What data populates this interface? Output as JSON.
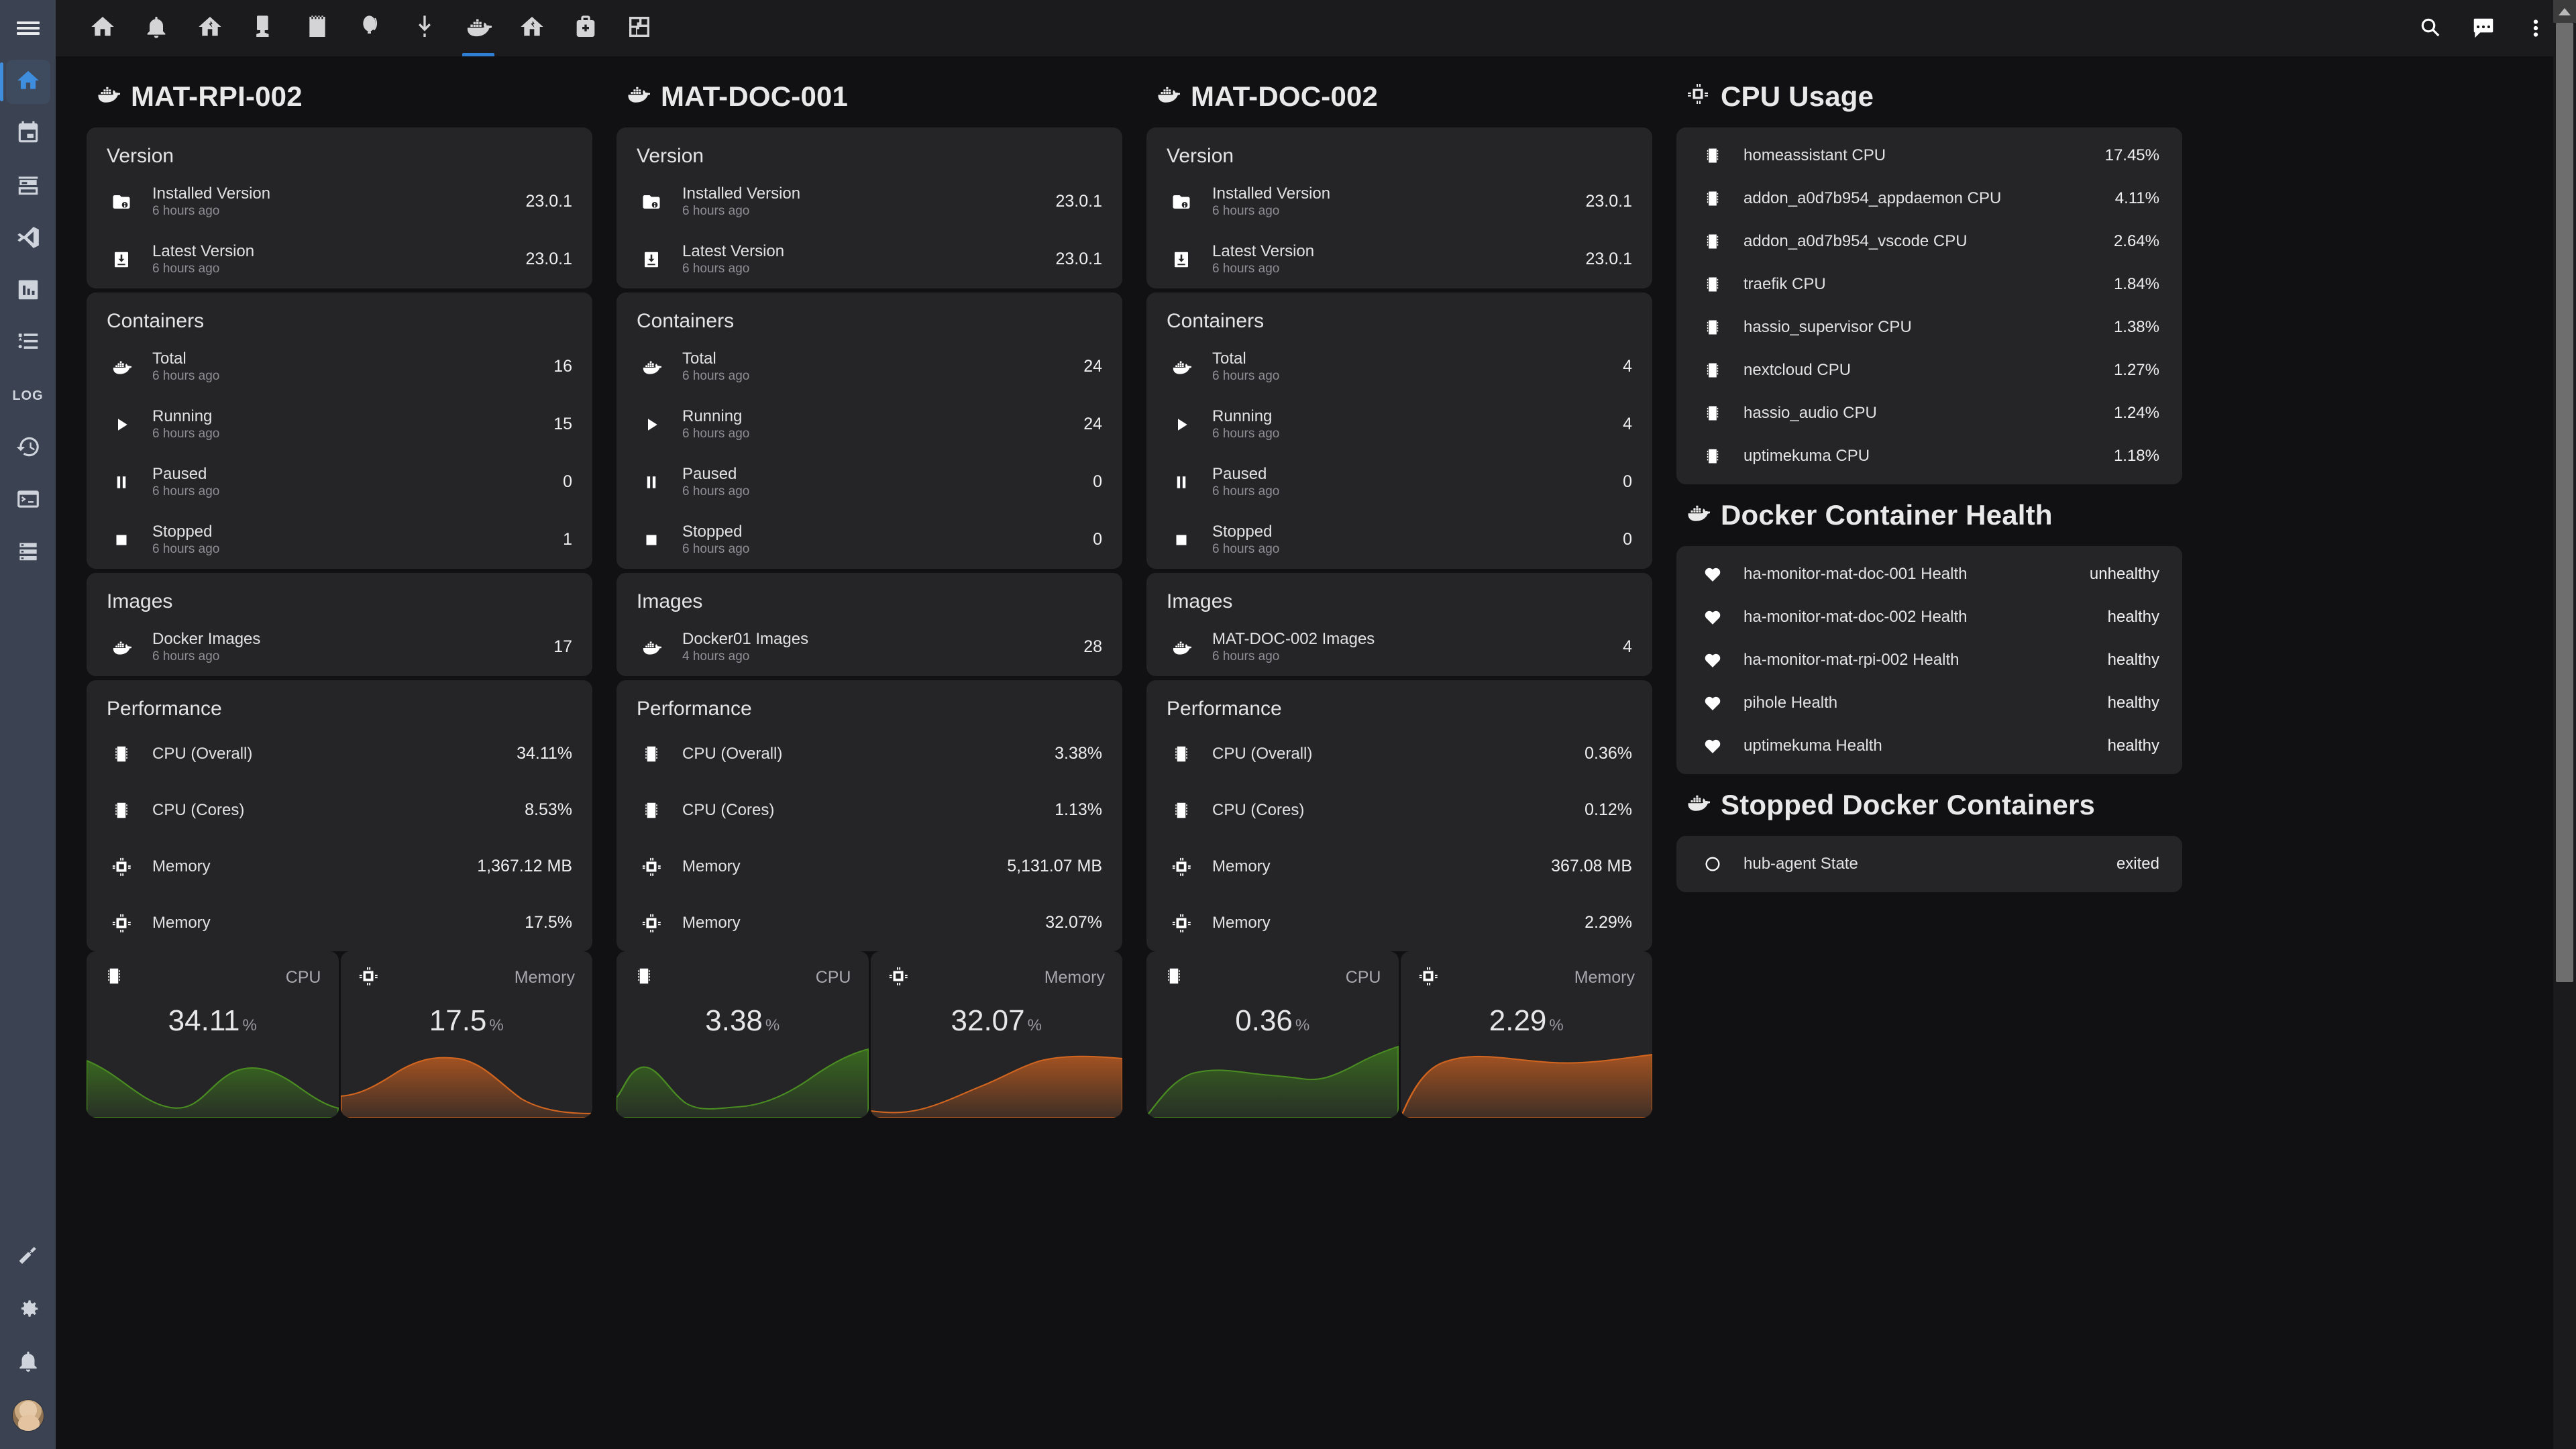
{
  "sidebar": {
    "hamburger": "menu-icon",
    "items": [
      {
        "id": "home",
        "icon": "home-icon",
        "label": "Home",
        "active": true
      },
      {
        "id": "calendar",
        "icon": "calendar-icon",
        "label": "Calendar",
        "active": false
      },
      {
        "id": "hacs",
        "icon": "hacs-icon",
        "label": "HACS",
        "active": false
      },
      {
        "id": "vscode",
        "icon": "vscode-icon",
        "label": "Studio Code Server",
        "active": false
      },
      {
        "id": "grafana",
        "icon": "chart-box-icon",
        "label": "Grafana",
        "active": false
      },
      {
        "id": "logbook",
        "icon": "format-list-icon",
        "label": "Logbook",
        "active": false
      },
      {
        "id": "log",
        "icon": "log-text",
        "label": "LOG",
        "active": false
      },
      {
        "id": "history",
        "icon": "history-icon",
        "label": "History",
        "active": false
      },
      {
        "id": "terminal",
        "icon": "terminal-icon",
        "label": "Terminal",
        "active": false
      },
      {
        "id": "server",
        "icon": "server-icon",
        "label": "Server",
        "active": false
      }
    ],
    "bottom": [
      {
        "id": "developer-tools",
        "icon": "hammer-icon",
        "label": "Developer tools"
      },
      {
        "id": "settings",
        "icon": "gear-icon",
        "label": "Settings"
      },
      {
        "id": "notifications",
        "icon": "bell-icon",
        "label": "Notifications"
      },
      {
        "id": "user",
        "icon": "avatar",
        "label": "User profile"
      }
    ]
  },
  "topbar": {
    "tabs": [
      {
        "id": "home",
        "icon": "home-icon",
        "active": false
      },
      {
        "id": "alerts",
        "icon": "bell-icon",
        "active": false
      },
      {
        "id": "network",
        "icon": "home-lightning-icon",
        "active": false
      },
      {
        "id": "devices",
        "icon": "device-icon",
        "active": false
      },
      {
        "id": "notes",
        "icon": "notebook-icon",
        "active": false
      },
      {
        "id": "weather",
        "icon": "balloon-icon",
        "active": false
      },
      {
        "id": "downloads",
        "icon": "download-icon",
        "active": false
      },
      {
        "id": "docker",
        "icon": "docker-icon",
        "active": true
      },
      {
        "id": "energy",
        "icon": "home-lightning-icon",
        "active": false
      },
      {
        "id": "health",
        "icon": "medical-bag-icon",
        "active": false
      },
      {
        "id": "floorplan",
        "icon": "floorplan-icon",
        "active": false
      }
    ],
    "actions": [
      {
        "id": "search",
        "icon": "search-icon"
      },
      {
        "id": "assist",
        "icon": "assist-chat-icon"
      },
      {
        "id": "overflow",
        "icon": "dots-vertical-icon"
      }
    ]
  },
  "hosts": [
    {
      "title": "MAT-RPI-002",
      "title_icon": "docker-icon",
      "version": {
        "heading": "Version",
        "rows": [
          {
            "icon": "folder-info-icon",
            "name": "Installed Version",
            "sub": "6 hours ago",
            "value": "23.0.1"
          },
          {
            "icon": "file-download-icon",
            "name": "Latest Version",
            "sub": "6 hours ago",
            "value": "23.0.1"
          }
        ]
      },
      "containers": {
        "heading": "Containers",
        "rows": [
          {
            "icon": "docker-icon",
            "name": "Total",
            "sub": "6 hours ago",
            "value": "16"
          },
          {
            "icon": "play-icon",
            "name": "Running",
            "sub": "6 hours ago",
            "value": "15"
          },
          {
            "icon": "pause-icon",
            "name": "Paused",
            "sub": "6 hours ago",
            "value": "0"
          },
          {
            "icon": "stop-icon",
            "name": "Stopped",
            "sub": "6 hours ago",
            "value": "1"
          }
        ]
      },
      "images": {
        "heading": "Images",
        "rows": [
          {
            "icon": "docker-icon",
            "name": "Docker Images",
            "sub": "6 hours ago",
            "value": "17"
          }
        ]
      },
      "performance": {
        "heading": "Performance",
        "rows": [
          {
            "icon": "memory-chip-icon",
            "name": "CPU (Overall)",
            "sub": "",
            "value": "34.11%"
          },
          {
            "icon": "memory-chip-icon",
            "name": "CPU (Cores)",
            "sub": "",
            "value": "8.53%"
          },
          {
            "icon": "cpu-chip-icon",
            "name": "Memory",
            "sub": "",
            "value": "1,367.12 MB"
          },
          {
            "icon": "cpu-chip-icon",
            "name": "Memory",
            "sub": "",
            "value": "17.5%"
          }
        ]
      },
      "gauges": [
        {
          "icon": "memory-chip-icon",
          "label": "CPU",
          "value": "34.11",
          "unit": "%",
          "color": "#3f7d1e"
        },
        {
          "icon": "cpu-chip-icon",
          "label": "Memory",
          "value": "17.5",
          "unit": "%",
          "color": "#b85a20"
        }
      ]
    },
    {
      "title": "MAT-DOC-001",
      "title_icon": "docker-icon",
      "version": {
        "heading": "Version",
        "rows": [
          {
            "icon": "folder-info-icon",
            "name": "Installed Version",
            "sub": "6 hours ago",
            "value": "23.0.1"
          },
          {
            "icon": "file-download-icon",
            "name": "Latest Version",
            "sub": "6 hours ago",
            "value": "23.0.1"
          }
        ]
      },
      "containers": {
        "heading": "Containers",
        "rows": [
          {
            "icon": "docker-icon",
            "name": "Total",
            "sub": "6 hours ago",
            "value": "24"
          },
          {
            "icon": "play-icon",
            "name": "Running",
            "sub": "6 hours ago",
            "value": "24"
          },
          {
            "icon": "pause-icon",
            "name": "Paused",
            "sub": "6 hours ago",
            "value": "0"
          },
          {
            "icon": "stop-icon",
            "name": "Stopped",
            "sub": "6 hours ago",
            "value": "0"
          }
        ]
      },
      "images": {
        "heading": "Images",
        "rows": [
          {
            "icon": "docker-icon",
            "name": "Docker01 Images",
            "sub": "4 hours ago",
            "value": "28"
          }
        ]
      },
      "performance": {
        "heading": "Performance",
        "rows": [
          {
            "icon": "memory-chip-icon",
            "name": "CPU (Overall)",
            "sub": "",
            "value": "3.38%"
          },
          {
            "icon": "memory-chip-icon",
            "name": "CPU (Cores)",
            "sub": "",
            "value": "1.13%"
          },
          {
            "icon": "cpu-chip-icon",
            "name": "Memory",
            "sub": "",
            "value": "5,131.07 MB"
          },
          {
            "icon": "cpu-chip-icon",
            "name": "Memory",
            "sub": "",
            "value": "32.07%"
          }
        ]
      },
      "gauges": [
        {
          "icon": "memory-chip-icon",
          "label": "CPU",
          "value": "3.38",
          "unit": "%",
          "color": "#3f7d1e"
        },
        {
          "icon": "cpu-chip-icon",
          "label": "Memory",
          "value": "32.07",
          "unit": "%",
          "color": "#b85a20"
        }
      ]
    },
    {
      "title": "MAT-DOC-002",
      "title_icon": "docker-icon",
      "version": {
        "heading": "Version",
        "rows": [
          {
            "icon": "folder-info-icon",
            "name": "Installed Version",
            "sub": "6 hours ago",
            "value": "23.0.1"
          },
          {
            "icon": "file-download-icon",
            "name": "Latest Version",
            "sub": "6 hours ago",
            "value": "23.0.1"
          }
        ]
      },
      "containers": {
        "heading": "Containers",
        "rows": [
          {
            "icon": "docker-icon",
            "name": "Total",
            "sub": "6 hours ago",
            "value": "4"
          },
          {
            "icon": "play-icon",
            "name": "Running",
            "sub": "6 hours ago",
            "value": "4"
          },
          {
            "icon": "pause-icon",
            "name": "Paused",
            "sub": "6 hours ago",
            "value": "0"
          },
          {
            "icon": "stop-icon",
            "name": "Stopped",
            "sub": "6 hours ago",
            "value": "0"
          }
        ]
      },
      "images": {
        "heading": "Images",
        "rows": [
          {
            "icon": "docker-icon",
            "name": "MAT-DOC-002 Images",
            "sub": "6 hours ago",
            "value": "4"
          }
        ]
      },
      "performance": {
        "heading": "Performance",
        "rows": [
          {
            "icon": "memory-chip-icon",
            "name": "CPU (Overall)",
            "sub": "",
            "value": "0.36%"
          },
          {
            "icon": "memory-chip-icon",
            "name": "CPU (Cores)",
            "sub": "",
            "value": "0.12%"
          },
          {
            "icon": "cpu-chip-icon",
            "name": "Memory",
            "sub": "",
            "value": "367.08 MB"
          },
          {
            "icon": "cpu-chip-icon",
            "name": "Memory",
            "sub": "",
            "value": "2.29%"
          }
        ]
      },
      "gauges": [
        {
          "icon": "memory-chip-icon",
          "label": "CPU",
          "value": "0.36",
          "unit": "%",
          "color": "#3f7d1e"
        },
        {
          "icon": "cpu-chip-icon",
          "label": "Memory",
          "value": "2.29",
          "unit": "%",
          "color": "#b85a20"
        }
      ]
    }
  ],
  "right": {
    "cpu_usage": {
      "title": "CPU Usage",
      "title_icon": "cpu-64-icon",
      "rows": [
        {
          "icon": "memory-chip-icon",
          "name": "homeassistant CPU",
          "value": "17.45%"
        },
        {
          "icon": "memory-chip-icon",
          "name": "addon_a0d7b954_appdaemon CPU",
          "value": "4.11%"
        },
        {
          "icon": "memory-chip-icon",
          "name": "addon_a0d7b954_vscode CPU",
          "value": "2.64%"
        },
        {
          "icon": "memory-chip-icon",
          "name": "traefik CPU",
          "value": "1.84%"
        },
        {
          "icon": "memory-chip-icon",
          "name": "hassio_supervisor CPU",
          "value": "1.38%"
        },
        {
          "icon": "memory-chip-icon",
          "name": "nextcloud CPU",
          "value": "1.27%"
        },
        {
          "icon": "memory-chip-icon",
          "name": "hassio_audio CPU",
          "value": "1.24%"
        },
        {
          "icon": "memory-chip-icon",
          "name": "uptimekuma CPU",
          "value": "1.18%"
        }
      ]
    },
    "container_health": {
      "title": "Docker Container Health",
      "title_icon": "docker-icon",
      "rows": [
        {
          "icon": "heart-pulse-icon",
          "name": "ha-monitor-mat-doc-001 Health",
          "value": "unhealthy"
        },
        {
          "icon": "heart-pulse-icon",
          "name": "ha-monitor-mat-doc-002 Health",
          "value": "healthy"
        },
        {
          "icon": "heart-pulse-icon",
          "name": "ha-monitor-mat-rpi-002 Health",
          "value": "healthy"
        },
        {
          "icon": "heart-pulse-icon",
          "name": "pihole Health",
          "value": "healthy"
        },
        {
          "icon": "heart-pulse-icon",
          "name": "uptimekuma Health",
          "value": "healthy"
        }
      ]
    },
    "stopped_containers": {
      "title": "Stopped Docker Containers",
      "title_icon": "docker-icon",
      "rows": [
        {
          "icon": "circle-outline-icon",
          "name": "hub-agent State",
          "value": "exited"
        }
      ]
    }
  },
  "chart_data": [
    {
      "type": "area",
      "title": "MAT-RPI-002 CPU",
      "series": [
        {
          "name": "CPU",
          "values": [
            42,
            30,
            16,
            9,
            8,
            12,
            26,
            34,
            24,
            14
          ]
        }
      ],
      "ylabel": "%",
      "color": "#3f7d1e"
    },
    {
      "type": "area",
      "title": "MAT-RPI-002 Memory",
      "series": [
        {
          "name": "Memory",
          "values": [
            6,
            10,
            22,
            38,
            50,
            52,
            44,
            26,
            10,
            4
          ]
        }
      ],
      "ylabel": "%",
      "color": "#b85a20"
    },
    {
      "type": "area",
      "title": "MAT-DOC-001 CPU",
      "series": [
        {
          "name": "CPU",
          "values": [
            16,
            30,
            20,
            8,
            5,
            6,
            7,
            12,
            26,
            42
          ]
        }
      ],
      "ylabel": "%",
      "color": "#3f7d1e"
    },
    {
      "type": "area",
      "title": "MAT-DOC-001 Memory",
      "series": [
        {
          "name": "Memory",
          "values": [
            3,
            2,
            2,
            5,
            12,
            22,
            30,
            42,
            45,
            44
          ]
        }
      ],
      "ylabel": "%",
      "color": "#b85a20"
    },
    {
      "type": "area",
      "title": "MAT-DOC-002 CPU",
      "series": [
        {
          "name": "CPU",
          "values": [
            2,
            16,
            30,
            34,
            33,
            31,
            30,
            29,
            34,
            46
          ]
        }
      ],
      "ylabel": "%",
      "color": "#3f7d1e"
    },
    {
      "type": "area",
      "title": "MAT-DOC-002 Memory",
      "series": [
        {
          "name": "Memory",
          "values": [
            2,
            22,
            42,
            48,
            47,
            44,
            43,
            44,
            45,
            47
          ]
        }
      ],
      "ylabel": "%",
      "color": "#b85a20"
    }
  ],
  "scrollbar": {
    "thumb_position_pct": 2,
    "thumb_size_pct": 66
  }
}
